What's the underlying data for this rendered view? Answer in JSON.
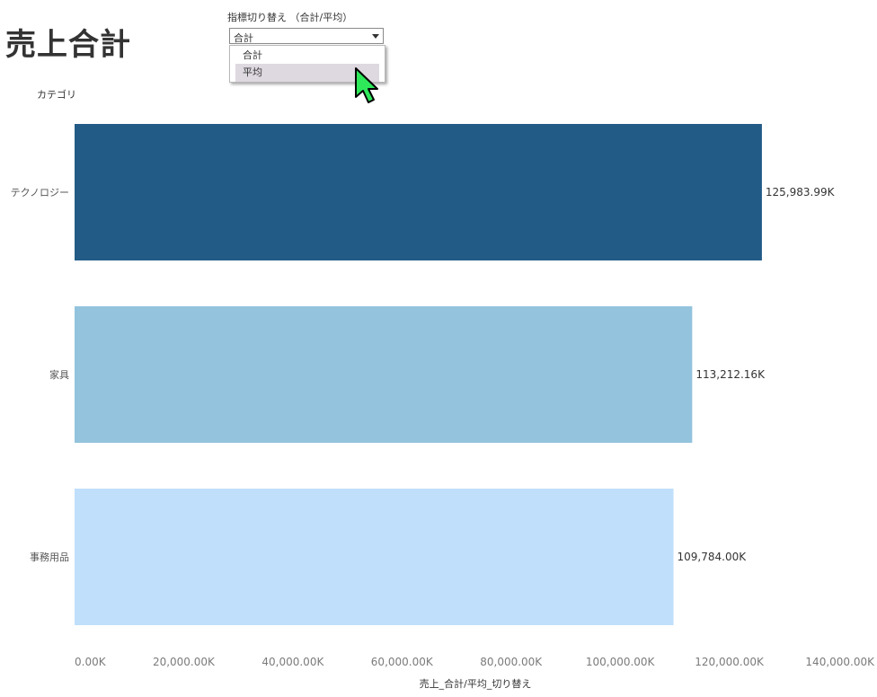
{
  "page": {
    "title": "売上合計"
  },
  "parameter": {
    "label": "指標切り替え （合計/平均）",
    "selected": "合計",
    "options": [
      {
        "label": "合計",
        "hovered": false
      },
      {
        "label": "平均",
        "hovered": true
      }
    ]
  },
  "icons": {
    "dropdown_caret": "chevron-down-icon",
    "cursor": "mouse-pointer-icon"
  },
  "colors": {
    "cursor_fill": "#2ee85a",
    "hover_bg": "#ded8e0"
  },
  "chart_data": {
    "type": "bar",
    "orientation": "horizontal",
    "row_header": "カテゴリ",
    "categories": [
      "テクノロジー",
      "家具",
      "事務用品"
    ],
    "values": [
      125983.99,
      113212.16,
      109784.0
    ],
    "data_labels": [
      "125,983.99K",
      "113,212.16K",
      "109,784.00K"
    ],
    "colors": [
      "#225b86",
      "#93c3dd",
      "#bfdffb"
    ],
    "xlabel": "売上_合計/平均_切り替え",
    "xlim": [
      0,
      140000
    ],
    "x_ticks": [
      {
        "value": 0,
        "label": "0.00K"
      },
      {
        "value": 20000,
        "label": "20,000.00K"
      },
      {
        "value": 40000,
        "label": "40,000.00K"
      },
      {
        "value": 60000,
        "label": "60,000.00K"
      },
      {
        "value": 80000,
        "label": "80,000.00K"
      },
      {
        "value": 100000,
        "label": "100,000.00K"
      },
      {
        "value": 120000,
        "label": "120,000.00K"
      },
      {
        "value": 140000,
        "label": "140,000.00K"
      }
    ],
    "grid": false,
    "legend": "none"
  }
}
